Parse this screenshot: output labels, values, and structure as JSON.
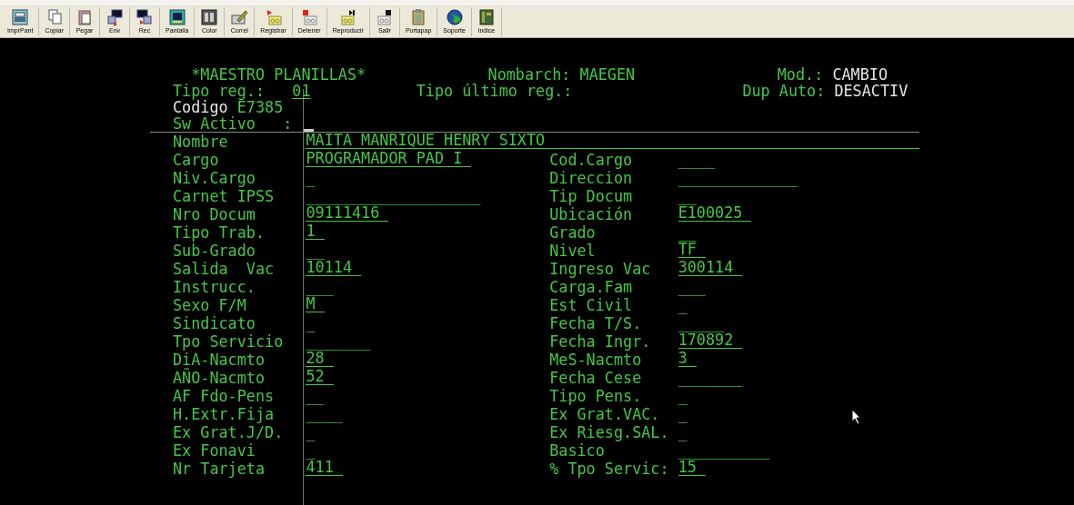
{
  "toolbar": [
    {
      "label": "ImprPant"
    },
    {
      "label": "Copiar"
    },
    {
      "label": "Pegar"
    },
    {
      "label": "Env"
    },
    {
      "label": "Rec"
    },
    {
      "label": "Pantalla"
    },
    {
      "label": "Color"
    },
    {
      "label": "Correl"
    },
    {
      "label": "Registrar"
    },
    {
      "label": "Detener"
    },
    {
      "label": "Reproducir"
    },
    {
      "label": "Salir"
    },
    {
      "label": "Portapap"
    },
    {
      "label": "Soporte"
    },
    {
      "label": "Indice"
    }
  ],
  "header": {
    "title": "*MAESTRO PLANILLAS*",
    "file_label": "Nombarch:",
    "file_value": "MAEGEN",
    "mode_label": "Mod.:",
    "mode_value": "CAMBIO",
    "record_type_label": "Tipo reg.:",
    "record_type_value": "01",
    "last_record_type_label": "Tipo último reg.:",
    "dup_label": "Dup Auto:",
    "dup_value": "DESACTIV",
    "code_label": "Codigo",
    "code_value": "E7385",
    "active_label": "Sw Activo   :"
  },
  "fields": [
    {
      "left": {
        "label": "Nombre",
        "value": "MAITA MANRIQUE HENRY SIXTO"
      }
    },
    {
      "left": {
        "label": "Cargo",
        "value": "PROGRAMADOR PAD I"
      },
      "right": {
        "label": "Cod.Cargo",
        "value": "____"
      }
    },
    {
      "left": {
        "label": "Niv.Cargo",
        "value": "_"
      },
      "right": {
        "label": "Direccion",
        "value": "_____________"
      }
    },
    {
      "left": {
        "label": "Carnet IPSS",
        "value": "___________________"
      },
      "right": {
        "label": "Tip Docum",
        "value": "__"
      }
    },
    {
      "left": {
        "label": "Nro Docum",
        "value": "09111416"
      },
      "right": {
        "label": "Ubicación",
        "value": "E100025"
      }
    },
    {
      "left": {
        "label": "Tipo Trab.",
        "value": "1"
      },
      "right": {
        "label": "Grado",
        "value": "__"
      }
    },
    {
      "left": {
        "label": "Sub-Grado",
        "value": "__"
      },
      "right": {
        "label": "Nivel",
        "value": "TF"
      }
    },
    {
      "left": {
        "label": "Salida  Vac",
        "value": "10114"
      },
      "right": {
        "label": "Ingreso Vac",
        "value": "300114"
      }
    },
    {
      "left": {
        "label": "Instrucc.",
        "value": "___"
      },
      "right": {
        "label": "Carga.Fam",
        "value": "___"
      }
    },
    {
      "left": {
        "label": "Sexo F/M",
        "value": "M"
      },
      "right": {
        "label": "Est Civil",
        "value": "_"
      }
    },
    {
      "left": {
        "label": "Sindicato",
        "value": "_"
      },
      "right": {
        "label": "Fecha T/S.",
        "value": "_____"
      }
    },
    {
      "left": {
        "label": "Tpo Servicio",
        "value": "_______"
      },
      "right": {
        "label": "Fecha Ingr.",
        "value": "170892"
      }
    },
    {
      "left": {
        "label": "DiA-Nacmto",
        "value": "28"
      },
      "right": {
        "label": "MeS-Nacmto",
        "value": "3"
      }
    },
    {
      "left": {
        "label": "AÑO-Nacmto",
        "value": "52"
      },
      "right": {
        "label": "Fecha Cese",
        "value": "_______"
      }
    },
    {
      "left": {
        "label": "AF Fdo-Pens",
        "value": "__"
      },
      "right": {
        "label": "Tipo Pens.",
        "value": "_"
      }
    },
    {
      "left": {
        "label": "H.Extr.Fija",
        "value": "____"
      },
      "right": {
        "label": "Ex Grat.VAC.",
        "value": "_"
      }
    },
    {
      "left": {
        "label": "Ex Grat.J/D.",
        "value": "_"
      },
      "right": {
        "label": "Ex Riesg.SAL.",
        "value": "_"
      }
    },
    {
      "left": {
        "label": "Ex Fonavi",
        "value": "_"
      },
      "right": {
        "label": "Basico",
        "value": "__________"
      }
    },
    {
      "left": {
        "label": "Nr Tarjeta",
        "value": "411"
      },
      "right": {
        "label": "% Tpo Servic:",
        "value": "15"
      }
    }
  ]
}
